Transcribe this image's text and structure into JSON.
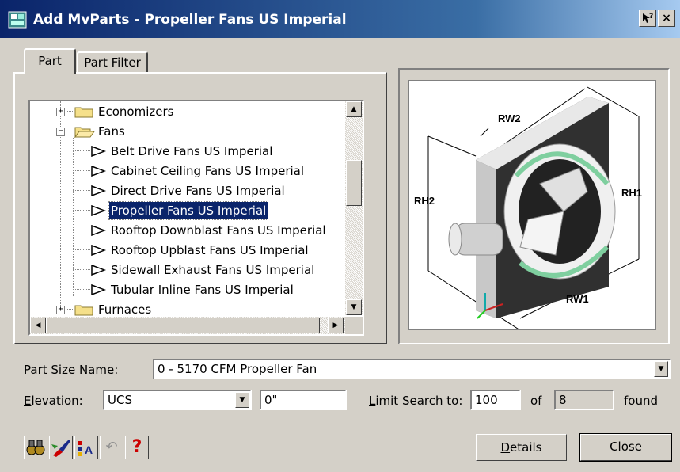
{
  "window": {
    "title": "Add MvParts - Propeller Fans US Imperial",
    "help_btn": "?",
    "close_btn": "×"
  },
  "tabs": [
    {
      "label": "Part",
      "active": true
    },
    {
      "label": "Part Filter",
      "active": false
    }
  ],
  "tree": {
    "items": [
      {
        "label": "Economizers",
        "type": "folder",
        "expanded": false
      },
      {
        "label": "Fans",
        "type": "folder",
        "expanded": true
      },
      {
        "label": "Belt Drive Fans US Imperial",
        "type": "part"
      },
      {
        "label": "Cabinet Ceiling Fans US Imperial",
        "type": "part"
      },
      {
        "label": "Direct Drive Fans US Imperial",
        "type": "part"
      },
      {
        "label": "Propeller Fans US Imperial",
        "type": "part",
        "selected": true
      },
      {
        "label": "Rooftop Downblast Fans US Imperial",
        "type": "part"
      },
      {
        "label": "Rooftop Upblast Fans US Imperial",
        "type": "part"
      },
      {
        "label": "Sidewall Exhaust Fans US Imperial",
        "type": "part"
      },
      {
        "label": "Tubular Inline Fans US Imperial",
        "type": "part"
      },
      {
        "label": "Furnaces",
        "type": "folder",
        "expanded": false
      }
    ]
  },
  "preview": {
    "labels": {
      "rw2": "RW2",
      "rh2": "RH2",
      "rh1": "RH1",
      "rw1": "RW1"
    }
  },
  "part_size": {
    "label_pre": "Part ",
    "label_key": "S",
    "label_post": "ize Name:",
    "value": "0 - 5170 CFM Propeller Fan"
  },
  "elevation": {
    "label_key": "E",
    "label_post": "levation:",
    "mode": "UCS",
    "value": "0\""
  },
  "limit": {
    "label_key": "L",
    "label_post": "imit Search to:",
    "value": "100",
    "of_label": "of",
    "found_value": "8",
    "found_label": "found"
  },
  "buttons": {
    "details_key": "D",
    "details_post": "etails",
    "close": "Close"
  },
  "toolbar": {
    "help_glyph": "?",
    "undo_glyph": "↶"
  },
  "colors": {
    "title_start": "#0a246a",
    "title_end": "#a6caf0",
    "selection": "#0a246a",
    "help_red": "#cc0000"
  }
}
